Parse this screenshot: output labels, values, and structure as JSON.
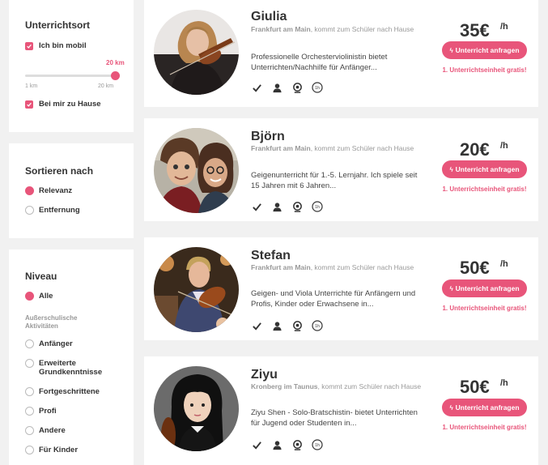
{
  "filters": {
    "location": {
      "title": "Unterrichtsort",
      "mobile_label": "Ich bin mobil",
      "slider_value": "20 km",
      "slider_min": "1 km",
      "slider_max": "20 km",
      "slider_level": 1.0,
      "home_label": "Bei mir zu Hause"
    },
    "sort": {
      "title": "Sortieren nach",
      "options": [
        "Relevanz",
        "Entfernung"
      ],
      "selected": "Relevanz"
    },
    "level": {
      "title": "Niveau",
      "all_label": "Alle",
      "group_label": "Außerschulische Aktivitäten",
      "options": [
        "Anfänger",
        "Erweiterte Grundkenntnisse",
        "Fortgeschrittene",
        "Profi",
        "Andere",
        "Für Kinder"
      ]
    }
  },
  "teachers": [
    {
      "name": "Giulia",
      "city": "Frankfurt am Main",
      "mode": ", kommt zum Schüler nach Hause",
      "description": "Professionelle Orchesterviolinistin bietet Unterrichten/Nachhilfe für Anfänger...",
      "price": "35€",
      "unit": "/h",
      "button": "Unterricht anfragen",
      "promo": "1. Unterrichtseinheit gratis!"
    },
    {
      "name": "Björn",
      "city": "Frankfurt am Main",
      "mode": ", kommt zum Schüler nach Hause",
      "description": "Geigenunterricht für 1.-5. Lernjahr. Ich spiele seit 15 Jahren mit 6 Jahren...",
      "price": "20€",
      "unit": "/h",
      "button": "Unterricht anfragen",
      "promo": "1. Unterrichtseinheit gratis!"
    },
    {
      "name": "Stefan",
      "city": "Frankfurt am Main",
      "mode": ", kommt zum Schüler nach Hause",
      "description": "Geigen- und Viola Unterrichte für Anfängern und Profis, Kinder oder Erwachsene in...",
      "price": "50€",
      "unit": "/h",
      "button": "Unterricht anfragen",
      "promo": "1. Unterrichtseinheit gratis!"
    },
    {
      "name": "Ziyu",
      "city": "Kronberg im Taunus",
      "mode": ", kommt zum Schüler nach Hause",
      "description": "Ziyu Shen - Solo-Bratschistin- bietet Unterrichten für Jugend oder Studenten in...",
      "price": "50€",
      "unit": "/h",
      "button": "Unterricht anfragen",
      "promo": "1. Unterrichtseinheit gratis!"
    }
  ],
  "badge_icons": [
    "check-icon",
    "person-icon",
    "webcam-icon",
    "first-hour-icon"
  ],
  "badge_text": "1h",
  "colors": {
    "accent": "#e8557a",
    "background": "#f1f1f1",
    "card": "#ffffff"
  }
}
